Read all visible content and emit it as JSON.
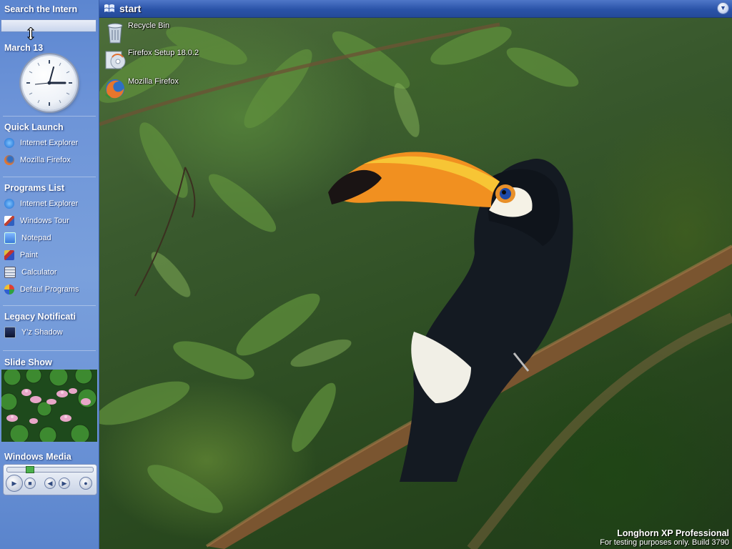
{
  "start_bar": {
    "label": "start",
    "toggle_icon": "chevron-down-icon"
  },
  "sidebar": {
    "search": {
      "value": "Search the Intern"
    },
    "date": "March 13",
    "quick_launch": {
      "title": "Quick Launch",
      "items": [
        {
          "label": "Internet Explorer",
          "icon": "internet-explorer-icon"
        },
        {
          "label": "Mozilla Firefox",
          "icon": "firefox-icon"
        }
      ]
    },
    "programs": {
      "title": "Programs List",
      "items": [
        {
          "label": "Internet Explorer",
          "icon": "internet-explorer-icon"
        },
        {
          "label": "Windows Tour",
          "icon": "windows-tour-icon"
        },
        {
          "label": "Notepad",
          "icon": "notepad-icon"
        },
        {
          "label": "Paint",
          "icon": "paint-icon"
        },
        {
          "label": "Calculator",
          "icon": "calculator-icon"
        },
        {
          "label": "Defaul Programs",
          "icon": "default-programs-icon"
        }
      ]
    },
    "legacy": {
      "title": "Legacy Notificati",
      "items": [
        {
          "label": "Y'z Shadow",
          "icon": "yz-shadow-icon"
        }
      ]
    },
    "slideshow": {
      "title": "Slide Show"
    },
    "media": {
      "title": "Windows Media"
    }
  },
  "desktop": {
    "icons": [
      {
        "label": "Recycle Bin",
        "icon": "recycle-bin-icon"
      },
      {
        "label": "Firefox Setup 18.0.2",
        "icon": "installer-cd-icon"
      },
      {
        "label": "Mozilla Firefox",
        "icon": "firefox-icon"
      }
    ],
    "watermark": {
      "title": "Longhorn XP Professional",
      "subtitle": "For testing purposes only. Build 3790"
    }
  },
  "colors": {
    "sidebar": "#6d94d8",
    "start_bar": "#2a53a8",
    "wallpaper": "#2f4f24"
  }
}
